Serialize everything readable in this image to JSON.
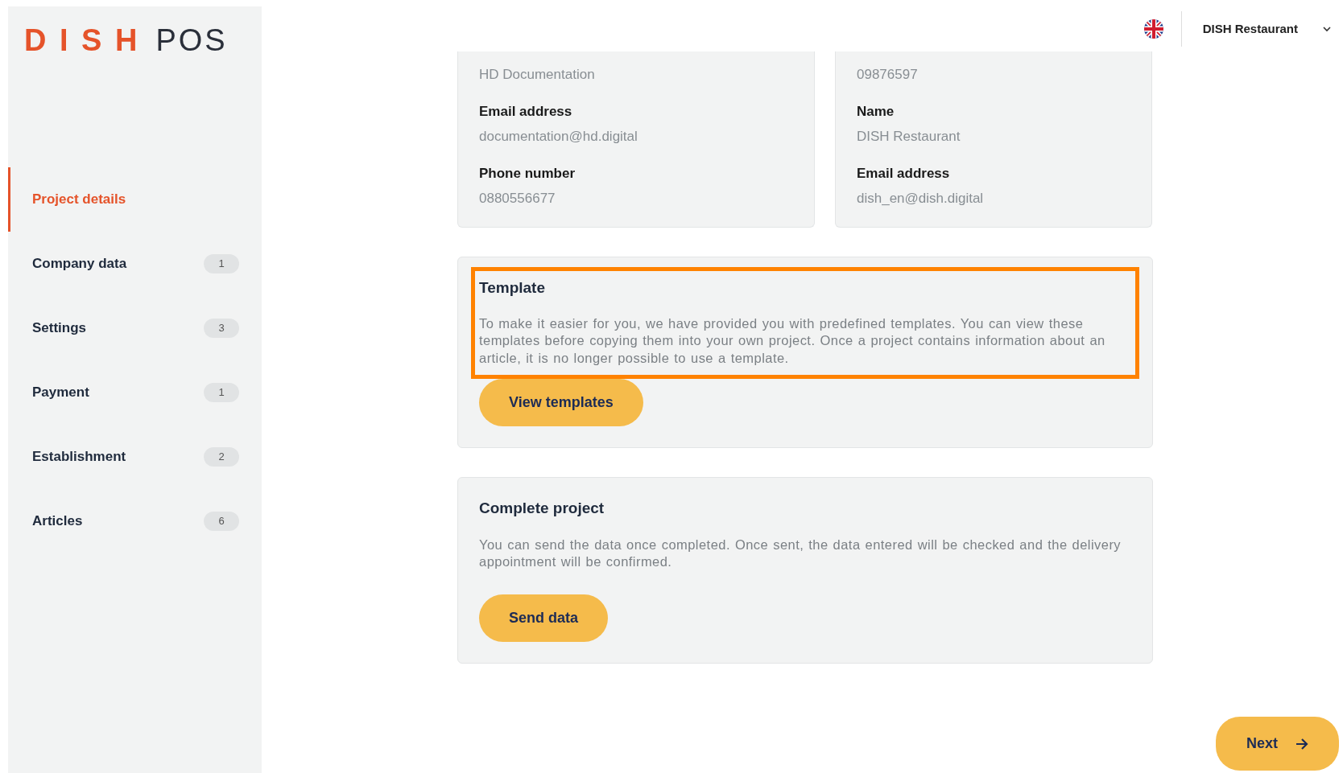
{
  "logo": {
    "brand": "D I S H",
    "product": "POS"
  },
  "sidebar": {
    "items": [
      {
        "label": "Project details",
        "selected": true
      },
      {
        "label": "Company data",
        "count": "1",
        "selected": false
      },
      {
        "label": "Settings",
        "count": "3",
        "selected": false
      },
      {
        "label": "Payment",
        "count": "1",
        "selected": false
      },
      {
        "label": "Establishment",
        "count": "2",
        "selected": false
      },
      {
        "label": "Articles",
        "count": "6",
        "selected": false
      }
    ]
  },
  "header": {
    "account": "DISH Restaurant"
  },
  "info_cards": [
    {
      "first_value": "HD Documentation",
      "fields": [
        {
          "label": "Email address",
          "value": "documentation@hd.digital"
        },
        {
          "label": "Phone number",
          "value": "0880556677"
        }
      ]
    },
    {
      "first_value": "09876597",
      "fields": [
        {
          "label": "Name",
          "value": "DISH Restaurant"
        },
        {
          "label": "Email address",
          "value": "dish_en@dish.digital"
        }
      ]
    }
  ],
  "sections": [
    {
      "title": "Template",
      "text": "To make it easier for you, we have provided you with predefined templates. You can view these templates before copying them into your own project. Once a project contains information about an article, it is no longer possible to use a template.",
      "button": "View templates",
      "highlighted": true
    },
    {
      "title": "Complete project",
      "text": "You can send the data once completed. Once sent, the data entered will be checked and the delivery appointment will be confirmed.",
      "button": "Send data",
      "highlighted": false
    }
  ],
  "next_button": "Next"
}
